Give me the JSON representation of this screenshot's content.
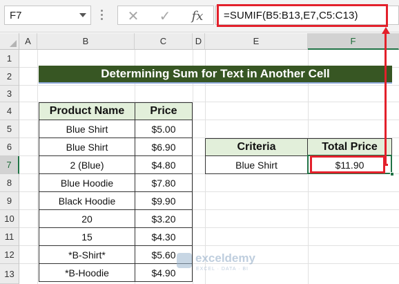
{
  "formula_bar": {
    "name_box": "F7",
    "cancel_icon": "✕",
    "enter_icon": "✓",
    "fx_label": "fx",
    "formula": "=SUMIF(B5:B13,E7,C5:C13)"
  },
  "columns": [
    "A",
    "B",
    "C",
    "D",
    "E",
    "F"
  ],
  "rows": [
    "1",
    "2",
    "3",
    "4",
    "5",
    "6",
    "7",
    "8",
    "9",
    "10",
    "11",
    "12",
    "13"
  ],
  "selected_cell": "F7",
  "title": "Determining Sum for Text in Another Cell",
  "product_table": {
    "headers": [
      "Product Name",
      "Price"
    ],
    "rows": [
      [
        "Blue Shirt",
        "$5.00"
      ],
      [
        "Blue Shirt",
        "$6.90"
      ],
      [
        "2 (Blue)",
        "$4.80"
      ],
      [
        "Blue Hoodie",
        "$7.80"
      ],
      [
        "Black Hoodie",
        "$9.90"
      ],
      [
        "20",
        "$3.20"
      ],
      [
        "15",
        "$4.30"
      ],
      [
        "*B-Shirt*",
        "$5.60"
      ],
      [
        "*B-Hoodie",
        "$4.90"
      ]
    ]
  },
  "criteria_table": {
    "headers": [
      "Criteria",
      "Total Price"
    ],
    "values": [
      "Blue Shirt",
      "$11.90"
    ]
  },
  "watermark": {
    "name": "exceldemy",
    "tagline": "EXCEL · DATA · BI"
  },
  "colors": {
    "title_bg": "#375623",
    "header_bg": "#e2efda",
    "highlight_red": "#e3202b",
    "excel_green": "#217346"
  }
}
